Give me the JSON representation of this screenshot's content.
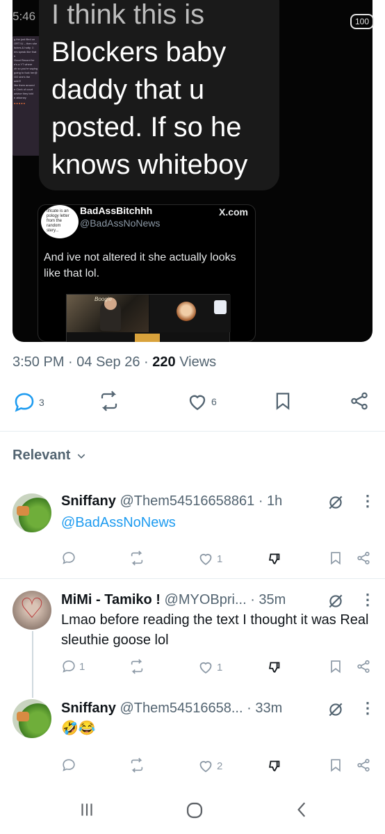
{
  "status_bar": {
    "time": "5:46",
    "battery": "100"
  },
  "media": {
    "side_doc_lines": [
      "g the just filed on",
      "",
      "ORT IU – then she",
      "itches & hotty ☺",
      "ers speak like that",
      "s",
      "",
      "Good Record for",
      "",
      "e's a YT where",
      "",
      "ch so you're saying",
      "going to fuck her@",
      "",
      "GO she's the",
      "ade!!!",
      "like them around",
      "",
      "e Clerk of court",
      "advice they told",
      "e attorney"
    ],
    "side_doc_dots": "●●●●●",
    "caption_lines": [
      "I think this is",
      "Blockers baby",
      "daddy that u",
      "posted. If so he",
      "knows whiteboy"
    ],
    "quote": {
      "avatar_text": [
        "tificate is an",
        "pology letter",
        "from the",
        "random",
        "stery..."
      ],
      "name": "BadAssBitchhh",
      "handle": "@BadAssNoNews",
      "source": "X.com",
      "text": "And ive not altered it she actually looks like that lol.",
      "thumb_label": "Boogie"
    }
  },
  "post_meta": {
    "time": "3:50 PM",
    "date": "04 Sep 26",
    "views_count": "220",
    "views_label": "Views"
  },
  "post_actions": {
    "replies": "3",
    "reposts": "",
    "likes": "6"
  },
  "filter": {
    "label": "Relevant"
  },
  "replies": [
    {
      "name": "Sniffany",
      "handle": "@Them54516658861",
      "time": "· 1h",
      "text": "@BadAssNoNews",
      "is_link": true,
      "replies": "",
      "reposts": "",
      "likes": "1"
    },
    {
      "name": "MiMi - Tamiko !",
      "handle": "@MYOBpri...",
      "time": "· 35m",
      "text": "Lmao before reading the text I thought it was Real sleuthie goose  lol",
      "is_link": false,
      "replies": "1",
      "reposts": "",
      "likes": "1"
    },
    {
      "name": "Sniffany",
      "handle": "@Them54516658...",
      "time": "· 33m",
      "text": "🤣😂",
      "is_link": false,
      "replies": "",
      "reposts": "",
      "likes": "2"
    }
  ],
  "colors": {
    "accent": "#1d9bf0",
    "muted": "#536471",
    "text": "#0f1419"
  }
}
